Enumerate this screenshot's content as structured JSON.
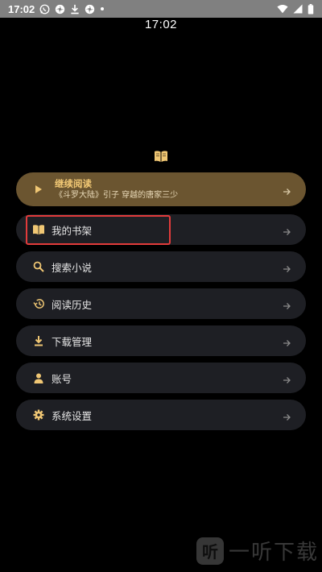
{
  "status_bar": {
    "time": "17:02",
    "icons_left": [
      "whatsapp-icon",
      "pinwheel-icon",
      "download-icon",
      "pinwheel-icon",
      "dot-icon"
    ],
    "icons_right": [
      "wifi-icon",
      "cellular-icon",
      "battery-icon"
    ]
  },
  "clock": "17:02",
  "continue_reading": {
    "title": "继续阅读",
    "subtitle": "《斗罗大陆》引子 穿越的唐家三少"
  },
  "menu": {
    "bookshelf": "我的书架",
    "search": "搜索小说",
    "history": "阅读历史",
    "downloads": "下载管理",
    "account": "账号",
    "settings": "系统设置"
  },
  "watermark": {
    "badge": "听",
    "text": "一听下载"
  },
  "colors": {
    "accent": "#f0c774",
    "continue_bg": "#6b5530",
    "item_bg": "#1e1f24",
    "highlight": "#e23b3b"
  }
}
